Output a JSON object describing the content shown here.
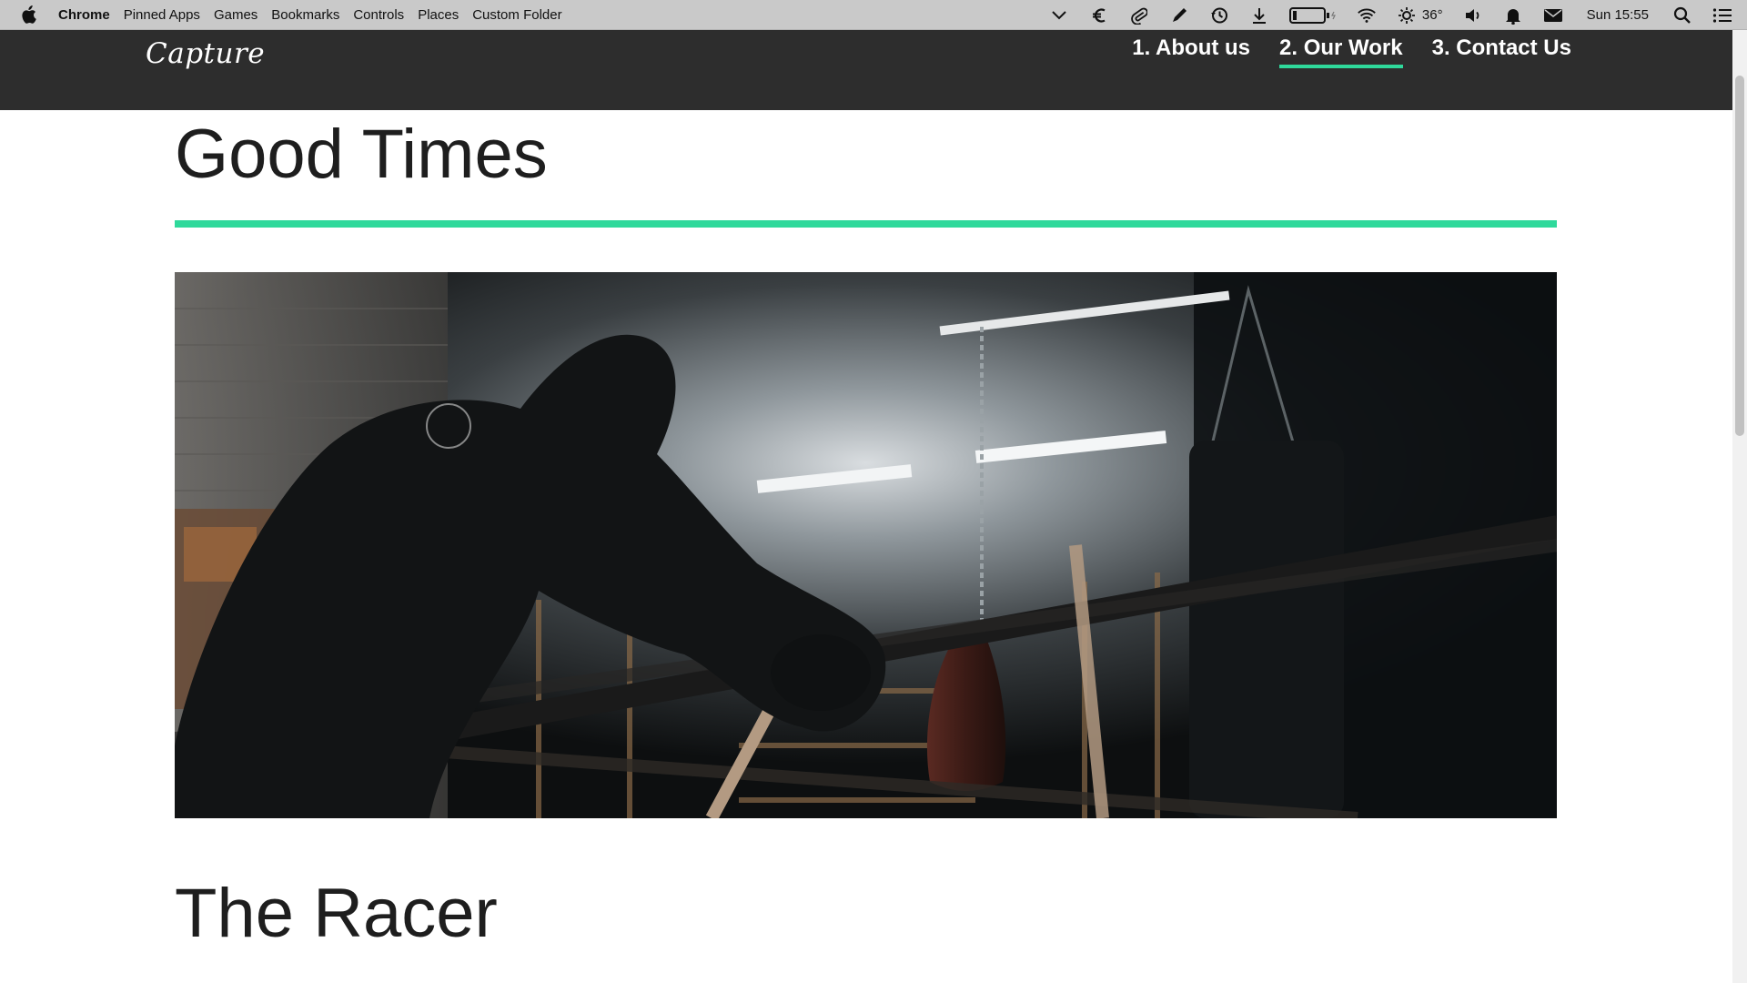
{
  "menubar": {
    "app_name": "Chrome",
    "menus": [
      "Pinned Apps",
      "Games",
      "Bookmarks",
      "Controls",
      "Places",
      "Custom Folder"
    ],
    "temperature": "36°",
    "clock": "Sun 15:55",
    "status_icons": [
      "chevron-down-icon",
      "euro-icon",
      "paperclip-icon",
      "pen-icon",
      "history-icon",
      "download-icon",
      "battery-icon",
      "wifi-icon",
      "weather-icon",
      "volume-icon",
      "bell-icon",
      "mail-icon",
      "search-icon",
      "list-icon"
    ]
  },
  "site": {
    "logo": "Capture",
    "nav": [
      {
        "label": "1. About us",
        "active": false
      },
      {
        "label": "2. Our Work",
        "active": true
      },
      {
        "label": "3. Contact Us",
        "active": false
      }
    ],
    "accent_color": "#2fd99b",
    "header_color": "#2d2d2d"
  },
  "content": {
    "section1_title": "Good Times",
    "section2_title": "The Racer"
  }
}
